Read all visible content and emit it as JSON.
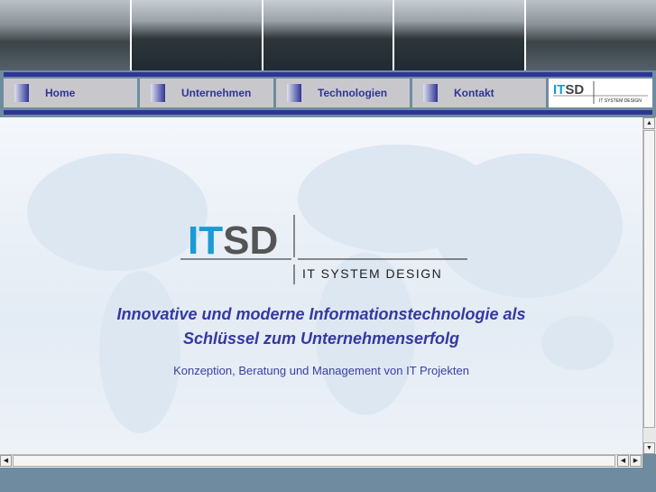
{
  "nav": {
    "items": [
      {
        "label": "Home"
      },
      {
        "label": "Unternehmen"
      },
      {
        "label": "Technologien"
      },
      {
        "label": "Kontakt"
      }
    ]
  },
  "brand": {
    "logo_text": "ITSD",
    "tagline": "IT SYSTEM DESIGN"
  },
  "main": {
    "slogan": "Innovative und moderne Informationstechnologie als Schlüssel zum Unternehmenserfolg",
    "subtitle": "Konzeption, Beratung und Management von IT Projekten"
  },
  "colors": {
    "accent": "#2f3597",
    "logo_blue": "#1b9ad6",
    "logo_gray": "#555555"
  }
}
